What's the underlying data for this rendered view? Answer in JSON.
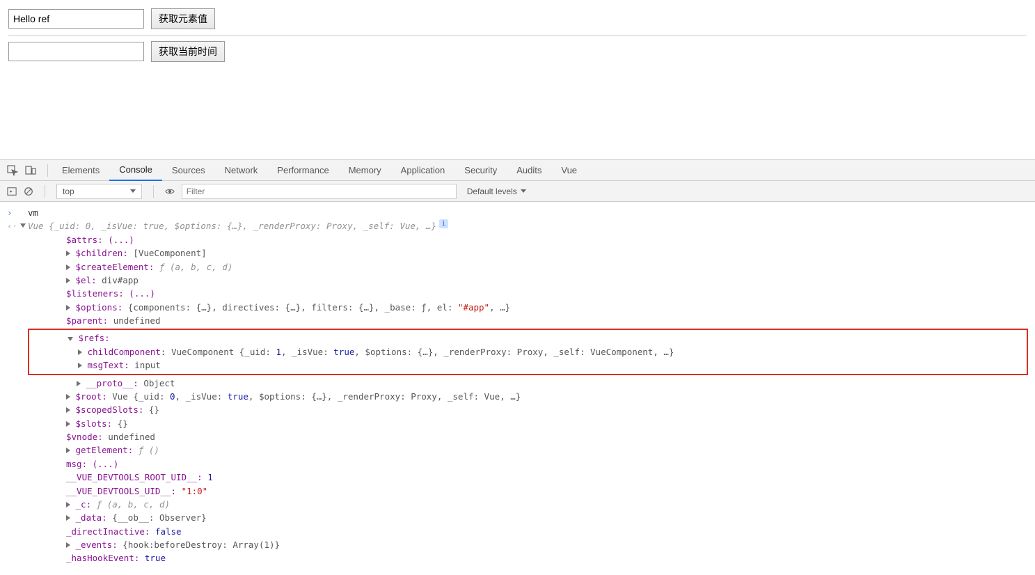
{
  "page": {
    "input1_value": "Hello ref",
    "button1_label": "获取元素值",
    "input2_value": "",
    "button2_label": "获取当前时间"
  },
  "devtools": {
    "tabs": [
      "Elements",
      "Console",
      "Sources",
      "Network",
      "Performance",
      "Memory",
      "Application",
      "Security",
      "Audits",
      "Vue"
    ],
    "active_tab": "Console",
    "execution_context": "top",
    "filter_placeholder": "Filter",
    "levels_label": "Default levels",
    "prompt_input": "vm"
  },
  "obj": {
    "header": "Vue {_uid: 0, _isVue: true, $options: {…}, _renderProxy: Proxy, _self: Vue, …}",
    "attrs": "$attrs: (...)",
    "children_k": "$children:",
    "children_v": " [VueComponent]",
    "createElement_k": "$createElement:",
    "createElement_v": "ƒ (a, b, c, d)",
    "el_k": "$el:",
    "el_v": " div#app",
    "listeners": "$listeners: (...)",
    "options_k": "$options:",
    "options_v_pre": " {components: {…}, directives: {…}, filters: {…}, _base: ƒ, el: ",
    "options_el": "\"#app\"",
    "options_v_post": ", …}",
    "parent_k": "$parent:",
    "parent_v": " undefined",
    "refs_k": "$refs:",
    "child_k": "childComponent:",
    "child_v_pre": " VueComponent {_uid: ",
    "child_uid": "1",
    "child_v_mid": ", _isVue: ",
    "child_isvue": "true",
    "child_v_post": ", $options: {…}, _renderProxy: Proxy, _self: VueComponent, …}",
    "msgText_k": "msgText:",
    "msgText_v": " input",
    "proto_k": "__proto__:",
    "proto_v": " Object",
    "root_k": "$root:",
    "root_v_pre": " Vue {_uid: ",
    "root_uid": "0",
    "root_v_mid": ", _isVue: ",
    "root_isvue": "true",
    "root_v_post": ", $options: {…}, _renderProxy: Proxy, _self: Vue, …}",
    "scopedSlots_k": "$scopedSlots:",
    "scopedSlots_v": " {}",
    "slots_k": "$slots:",
    "slots_v": " {}",
    "vnode_k": "$vnode:",
    "vnode_v": " undefined",
    "getElement_k": "getElement:",
    "getElement_v": "ƒ ()",
    "msg": "msg: (...)",
    "rootuid_k": "__VUE_DEVTOOLS_ROOT_UID__:",
    "rootuid_v": " 1",
    "uid_k": "__VUE_DEVTOOLS_UID__:",
    "uid_v": "\"1:0\"",
    "c_k": "_c:",
    "c_v": "ƒ (a, b, c, d)",
    "data_k": "_data:",
    "data_v": " {__ob__: Observer}",
    "directInactive_k": "_directInactive:",
    "directInactive_v": " false",
    "events_k": "_events:",
    "events_v": " {hook:beforeDestroy: Array(1)}",
    "hasHookEvent_k": "_hasHookEvent:",
    "hasHookEvent_v": " true"
  }
}
